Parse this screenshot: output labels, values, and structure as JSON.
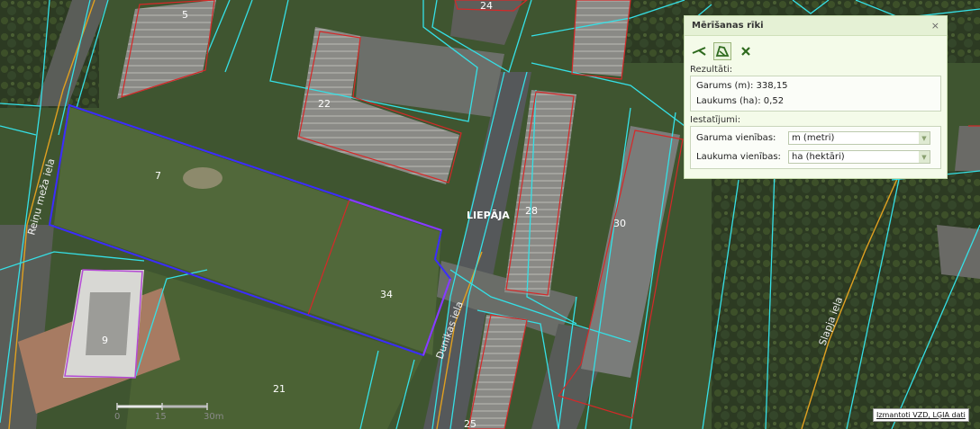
{
  "map": {
    "city_label": "LIEPĀJA",
    "parcel_numbers": [
      "5",
      "24",
      "22",
      "7",
      "28",
      "30",
      "34",
      "9",
      "21",
      "25"
    ],
    "streets": [
      "Reiņu meža iela",
      "Dunikas iela",
      "Slapja iela"
    ],
    "scale": {
      "labels": [
        "0",
        "15",
        "30m"
      ]
    },
    "attribution": "Izmantoti VZD, LĢIA dati"
  },
  "panel": {
    "title": "Mērīšanas rīki",
    "close_symbol": "×",
    "tools": [
      {
        "icon": "measure-distance-icon",
        "active": false
      },
      {
        "icon": "measure-area-icon",
        "active": true
      },
      {
        "icon": "clear-icon",
        "active": false
      }
    ],
    "results_label": "Rezultāti:",
    "length_line": "Garums (m): 338,15",
    "area_line": "Laukums (ha): 0,52",
    "settings_label": "Iestatījumi:",
    "length_unit_label": "Garuma vienības:",
    "length_unit_value": "m (metri)",
    "area_unit_label": "Laukuma vienības:",
    "area_unit_value": "ha (hektāri)"
  },
  "colors": {
    "measure_line": "#3b2cff",
    "parcel_border": "#d62828",
    "cadastre_line": "#35e0e6",
    "road_line": "#e0a020"
  }
}
